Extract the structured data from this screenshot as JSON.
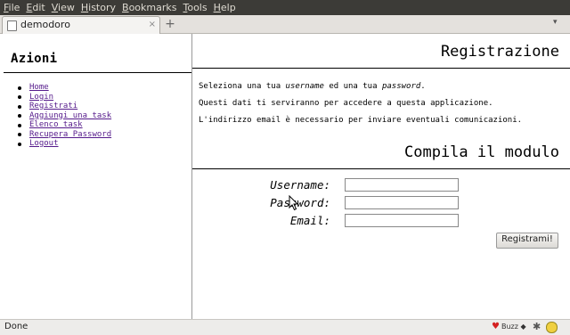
{
  "menubar": [
    "File",
    "Edit",
    "View",
    "History",
    "Bookmarks",
    "Tools",
    "Help"
  ],
  "tab": {
    "title": "demodoro",
    "close": "×",
    "new_tab": "+",
    "menu": "▾"
  },
  "sidebar": {
    "title": "Azioni",
    "items": [
      "Home",
      "Login",
      "Registrati",
      "Aggiungi una task",
      "Elenco task",
      "Recupera Password",
      "Logout"
    ]
  },
  "main": {
    "title": "Registrazione",
    "intro_1_a": "Seleziona una tua ",
    "intro_1_b": "username",
    "intro_1_c": " ed una tua ",
    "intro_1_d": "password",
    "intro_1_e": ".",
    "intro_2": "Questi dati ti serviranno per accedere a questa applicazione.",
    "intro_3": "L'indirizzo email è necessario per inviare eventuali comunicazioni.",
    "form_title": "Compila il modulo",
    "fields": [
      {
        "label": "Username:",
        "value": ""
      },
      {
        "label": "Password:",
        "value": ""
      },
      {
        "label": "Email:",
        "value": ""
      }
    ],
    "submit": "Registrami!"
  },
  "status": {
    "text": "Done",
    "addon": "Buzz ◆",
    "heart": "♥",
    "gear": "✱"
  }
}
